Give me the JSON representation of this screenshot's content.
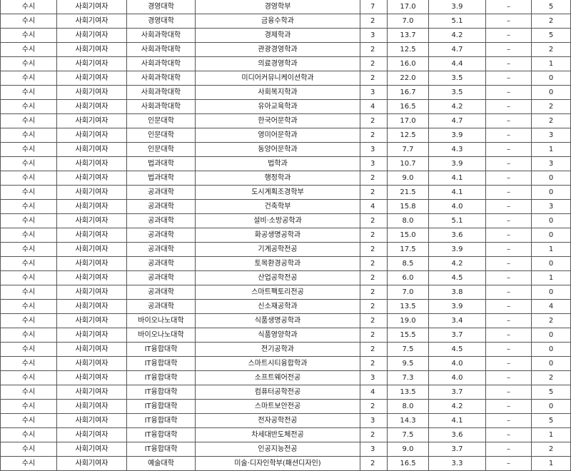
{
  "table": {
    "rows": [
      [
        "수시",
        "사회기여자",
        "경영대학",
        "경영학부",
        "7",
        "17.0",
        "3.9",
        "–",
        "5"
      ],
      [
        "수시",
        "사회기여자",
        "경영대학",
        "금융수학과",
        "2",
        "7.0",
        "5.1",
        "–",
        "2"
      ],
      [
        "수시",
        "사회기여자",
        "사회과학대학",
        "경제학과",
        "3",
        "13.7",
        "4.2",
        "–",
        "5"
      ],
      [
        "수시",
        "사회기여자",
        "사회과학대학",
        "관광경영학과",
        "2",
        "12.5",
        "4.7",
        "–",
        "2"
      ],
      [
        "수시",
        "사회기여자",
        "사회과학대학",
        "의료경영학과",
        "2",
        "16.0",
        "4.4",
        "–",
        "1"
      ],
      [
        "수시",
        "사회기여자",
        "사회과학대학",
        "미디어커뮤니케이션학과",
        "2",
        "22.0",
        "3.5",
        "–",
        "0"
      ],
      [
        "수시",
        "사회기여자",
        "사회과학대학",
        "사회복지학과",
        "3",
        "16.7",
        "3.5",
        "–",
        "0"
      ],
      [
        "수시",
        "사회기여자",
        "사회과학대학",
        "유아교육학과",
        "4",
        "16.5",
        "4.2",
        "–",
        "2"
      ],
      [
        "수시",
        "사회기여자",
        "인문대학",
        "한국어문학과",
        "2",
        "17.0",
        "4.7",
        "–",
        "2"
      ],
      [
        "수시",
        "사회기여자",
        "인문대학",
        "영미어문학과",
        "2",
        "12.5",
        "3.9",
        "–",
        "3"
      ],
      [
        "수시",
        "사회기여자",
        "인문대학",
        "동양어문학과",
        "3",
        "7.7",
        "4.3",
        "–",
        "1"
      ],
      [
        "수시",
        "사회기여자",
        "법과대학",
        "법학과",
        "3",
        "10.7",
        "3.9",
        "–",
        "3"
      ],
      [
        "수시",
        "사회기여자",
        "법과대학",
        "행정학과",
        "2",
        "9.0",
        "4.1",
        "–",
        "0"
      ],
      [
        "수시",
        "사회기여자",
        "공과대학",
        "도시계획조경학부",
        "2",
        "21.5",
        "4.1",
        "–",
        "0"
      ],
      [
        "수시",
        "사회기여자",
        "공과대학",
        "건축학부",
        "4",
        "15.8",
        "4.0",
        "–",
        "3"
      ],
      [
        "수시",
        "사회기여자",
        "공과대학",
        "설비·소방공학과",
        "2",
        "8.0",
        "5.1",
        "–",
        "0"
      ],
      [
        "수시",
        "사회기여자",
        "공과대학",
        "화공생명공학과",
        "2",
        "15.0",
        "3.6",
        "–",
        "0"
      ],
      [
        "수시",
        "사회기여자",
        "공과대학",
        "기계공학전공",
        "2",
        "17.5",
        "3.9",
        "–",
        "1"
      ],
      [
        "수시",
        "사회기여자",
        "공과대학",
        "토목환경공학과",
        "2",
        "8.5",
        "4.2",
        "–",
        "0"
      ],
      [
        "수시",
        "사회기여자",
        "공과대학",
        "산업공학전공",
        "2",
        "6.0",
        "4.5",
        "–",
        "1"
      ],
      [
        "수시",
        "사회기여자",
        "공과대학",
        "스마트팩토리전공",
        "2",
        "7.0",
        "3.8",
        "–",
        "0"
      ],
      [
        "수시",
        "사회기여자",
        "공과대학",
        "신소재공학과",
        "2",
        "13.5",
        "3.9",
        "–",
        "4"
      ],
      [
        "수시",
        "사회기여자",
        "바이오나노대학",
        "식품생명공학과",
        "2",
        "19.0",
        "3.4",
        "–",
        "2"
      ],
      [
        "수시",
        "사회기여자",
        "바이오나노대학",
        "식품영양학과",
        "2",
        "15.5",
        "3.7",
        "–",
        "0"
      ],
      [
        "수시",
        "사회기여자",
        "IT융합대학",
        "전기공학과",
        "2",
        "7.5",
        "4.5",
        "–",
        "0"
      ],
      [
        "수시",
        "사회기여자",
        "IT융합대학",
        "스마트시티융합학과",
        "2",
        "9.5",
        "4.0",
        "–",
        "0"
      ],
      [
        "수시",
        "사회기여자",
        "IT융합대학",
        "소프트웨어전공",
        "3",
        "7.3",
        "4.0",
        "–",
        "2"
      ],
      [
        "수시",
        "사회기여자",
        "IT융합대학",
        "컴퓨터공학전공",
        "4",
        "13.5",
        "3.7",
        "–",
        "5"
      ],
      [
        "수시",
        "사회기여자",
        "IT융합대학",
        "스마트보안전공",
        "2",
        "8.0",
        "4.2",
        "–",
        "0"
      ],
      [
        "수시",
        "사회기여자",
        "IT융합대학",
        "전자공학전공",
        "3",
        "14.3",
        "4.1",
        "–",
        "5"
      ],
      [
        "수시",
        "사회기여자",
        "IT융합대학",
        "차세대반도체전공",
        "2",
        "7.5",
        "3.6",
        "–",
        "1"
      ],
      [
        "수시",
        "사회기여자",
        "IT융합대학",
        "인공지능전공",
        "3",
        "9.0",
        "3.7",
        "–",
        "2"
      ],
      [
        "수시",
        "사회기여자",
        "예술대학",
        "미술·디자인학부(패션디자인)",
        "2",
        "16.5",
        "3.3",
        "–",
        "1"
      ]
    ]
  }
}
